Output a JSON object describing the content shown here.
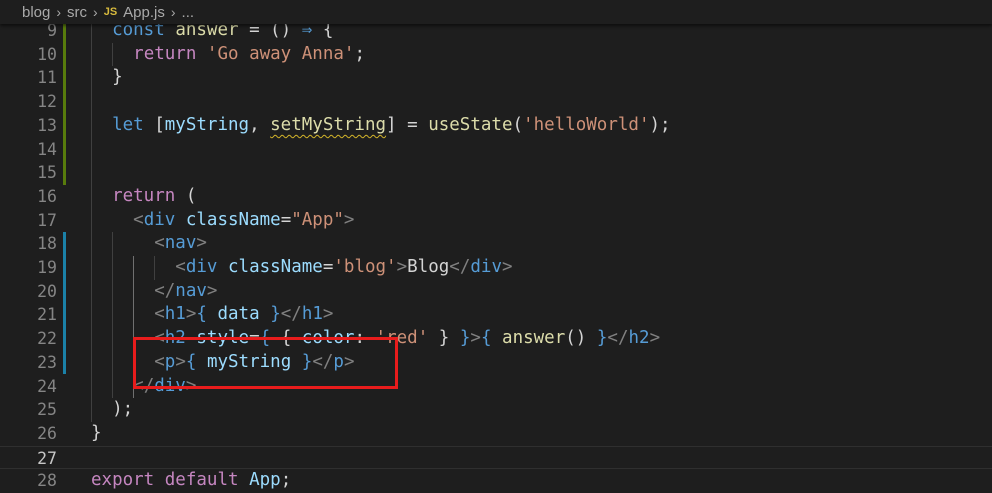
{
  "breadcrumb": {
    "items": [
      "blog",
      "src",
      "App.js",
      "..."
    ],
    "js_badge": "JS"
  },
  "colors": {
    "keyword": "#569cd6",
    "control": "#c586c0",
    "variable": "#9cdcfe",
    "function": "#dcdcaa",
    "string": "#ce9178",
    "tag_bracket": "#808080",
    "highlight_box": "#e81c1c"
  },
  "editor": {
    "active_line": 27,
    "lines": [
      {
        "n": "9",
        "tokens": [
          [
            "  ",
            "plain"
          ],
          [
            "const",
            "kw"
          ],
          [
            " ",
            "plain"
          ],
          [
            "answer",
            "fn"
          ],
          [
            " = () ",
            "plain"
          ],
          [
            "⇒",
            "kw"
          ],
          [
            " {",
            "plain"
          ]
        ]
      },
      {
        "n": "10",
        "tokens": [
          [
            "    ",
            "plain"
          ],
          [
            "return",
            "ctl"
          ],
          [
            " ",
            "plain"
          ],
          [
            "'Go away Anna'",
            "str"
          ],
          [
            ";",
            "plain"
          ]
        ]
      },
      {
        "n": "11",
        "tokens": [
          [
            "  }",
            "plain"
          ]
        ]
      },
      {
        "n": "12",
        "tokens": []
      },
      {
        "n": "13",
        "tokens": [
          [
            "  ",
            "plain"
          ],
          [
            "let",
            "kw"
          ],
          [
            " [",
            "plain"
          ],
          [
            "myString",
            "var"
          ],
          [
            ", ",
            "plain"
          ],
          [
            "setMyString",
            "fn-warn"
          ],
          [
            "] = ",
            "plain"
          ],
          [
            "useState",
            "fn"
          ],
          [
            "(",
            "plain"
          ],
          [
            "'helloWorld'",
            "str"
          ],
          [
            ");",
            "plain"
          ]
        ]
      },
      {
        "n": "14",
        "tokens": []
      },
      {
        "n": "15",
        "tokens": []
      },
      {
        "n": "16",
        "tokens": [
          [
            "  ",
            "plain"
          ],
          [
            "return",
            "ctl"
          ],
          [
            " (",
            "plain"
          ]
        ]
      },
      {
        "n": "17",
        "tokens": [
          [
            "    ",
            "plain"
          ],
          [
            "<",
            "punc"
          ],
          [
            "div",
            "tag"
          ],
          [
            " ",
            "plain"
          ],
          [
            "className",
            "attr"
          ],
          [
            "=",
            "plain"
          ],
          [
            "\"App\"",
            "str"
          ],
          [
            ">",
            "punc"
          ]
        ]
      },
      {
        "n": "18",
        "tokens": [
          [
            "      ",
            "plain"
          ],
          [
            "<",
            "punc"
          ],
          [
            "nav",
            "tag"
          ],
          [
            ">",
            "punc"
          ]
        ]
      },
      {
        "n": "19",
        "tokens": [
          [
            "        ",
            "plain"
          ],
          [
            "<",
            "punc"
          ],
          [
            "div",
            "tag"
          ],
          [
            " ",
            "plain"
          ],
          [
            "className",
            "attr"
          ],
          [
            "=",
            "plain"
          ],
          [
            "'blog'",
            "str"
          ],
          [
            ">",
            "punc"
          ],
          [
            "Blog",
            "plain"
          ],
          [
            "</",
            "punc"
          ],
          [
            "div",
            "tag"
          ],
          [
            ">",
            "punc"
          ]
        ]
      },
      {
        "n": "20",
        "tokens": [
          [
            "      ",
            "plain"
          ],
          [
            "</",
            "punc"
          ],
          [
            "nav",
            "tag"
          ],
          [
            ">",
            "punc"
          ]
        ]
      },
      {
        "n": "21",
        "tokens": [
          [
            "      ",
            "plain"
          ],
          [
            "<",
            "punc"
          ],
          [
            "h1",
            "tag"
          ],
          [
            ">",
            "punc"
          ],
          [
            "{",
            "brace"
          ],
          [
            " ",
            "plain"
          ],
          [
            "data",
            "var"
          ],
          [
            " ",
            "plain"
          ],
          [
            "}",
            "brace"
          ],
          [
            "</",
            "punc"
          ],
          [
            "h1",
            "tag"
          ],
          [
            ">",
            "punc"
          ]
        ]
      },
      {
        "n": "22",
        "tokens": [
          [
            "      ",
            "plain"
          ],
          [
            "<",
            "punc"
          ],
          [
            "h2",
            "tag"
          ],
          [
            " ",
            "plain"
          ],
          [
            "style",
            "attr"
          ],
          [
            "=",
            "plain"
          ],
          [
            "{",
            "brace"
          ],
          [
            " { ",
            "plain"
          ],
          [
            "color",
            "var"
          ],
          [
            ": ",
            "plain"
          ],
          [
            "'red'",
            "str"
          ],
          [
            " } ",
            "plain"
          ],
          [
            "}",
            "brace"
          ],
          [
            ">",
            "punc"
          ],
          [
            "{",
            "brace"
          ],
          [
            " ",
            "plain"
          ],
          [
            "answer",
            "fn"
          ],
          [
            "() ",
            "plain"
          ],
          [
            "}",
            "brace"
          ],
          [
            "</",
            "punc"
          ],
          [
            "h2",
            "tag"
          ],
          [
            ">",
            "punc"
          ]
        ]
      },
      {
        "n": "23",
        "tokens": [
          [
            "      ",
            "plain"
          ],
          [
            "<",
            "punc"
          ],
          [
            "p",
            "tag"
          ],
          [
            ">",
            "punc"
          ],
          [
            "{",
            "brace"
          ],
          [
            " ",
            "plain"
          ],
          [
            "myString",
            "var"
          ],
          [
            " ",
            "plain"
          ],
          [
            "}",
            "brace"
          ],
          [
            "</",
            "punc"
          ],
          [
            "p",
            "tag"
          ],
          [
            ">",
            "punc"
          ]
        ]
      },
      {
        "n": "24",
        "tokens": [
          [
            "    ",
            "plain"
          ],
          [
            "</",
            "punc"
          ],
          [
            "div",
            "tag"
          ],
          [
            ">",
            "punc"
          ]
        ]
      },
      {
        "n": "25",
        "tokens": [
          [
            "  );",
            "plain"
          ]
        ]
      },
      {
        "n": "26",
        "tokens": [
          [
            "}",
            "plain"
          ]
        ]
      },
      {
        "n": "27",
        "tokens": []
      },
      {
        "n": "28",
        "tokens": [
          [
            "export",
            "ctl"
          ],
          [
            " ",
            "plain"
          ],
          [
            "default",
            "ctl"
          ],
          [
            " ",
            "plain"
          ],
          [
            "App",
            "var"
          ],
          [
            ";",
            "plain"
          ]
        ]
      }
    ]
  }
}
